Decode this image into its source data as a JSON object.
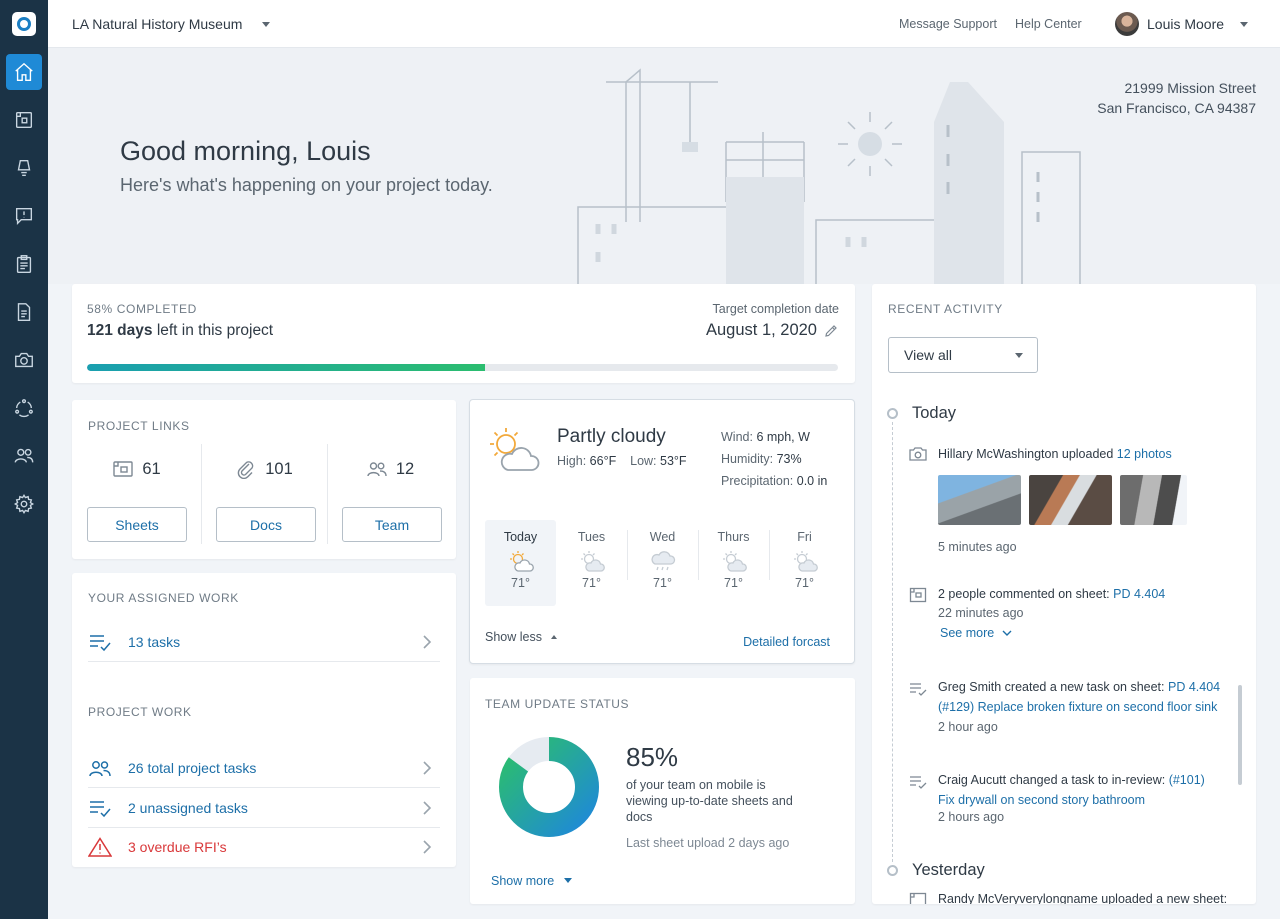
{
  "app": {
    "project_name": "LA Natural History Museum"
  },
  "topbar": {
    "message_support": "Message Support",
    "help_center": "Help Center",
    "user_name": "Louis Moore"
  },
  "sidebar": {
    "items": [
      {
        "icon": "home-icon",
        "active": true
      },
      {
        "icon": "sheets-icon",
        "active": false
      },
      {
        "icon": "tasks-icon",
        "active": false
      },
      {
        "icon": "rfi-icon",
        "active": false
      },
      {
        "icon": "clipboard-icon",
        "active": false
      },
      {
        "icon": "docs-icon",
        "active": false
      },
      {
        "icon": "camera-icon",
        "active": false
      },
      {
        "icon": "network-icon",
        "active": false
      },
      {
        "icon": "team-icon",
        "active": false
      },
      {
        "icon": "settings-icon",
        "active": false
      }
    ]
  },
  "hero": {
    "greeting": "Good morning, Louis",
    "subgreeting": "Here's what's happening on your project today.",
    "address_line1": "21999 Mission Street",
    "address_line2": "San Francisco, CA 94387"
  },
  "progress": {
    "completed_label": "58% COMPLETED",
    "completed_fraction": 0.53,
    "days_bold": "121 days",
    "days_rest": "left in this project",
    "target_label": "Target completion date",
    "target_date": "August 1, 2020"
  },
  "project_links": {
    "label": "PROJECT LINKS",
    "items": [
      {
        "count": "61",
        "button": "Sheets",
        "icon": "sheets-icon"
      },
      {
        "count": "101",
        "button": "Docs",
        "icon": "paperclip-icon"
      },
      {
        "count": "12",
        "button": "Team",
        "icon": "team-icon"
      }
    ]
  },
  "assigned_work": {
    "label": "YOUR ASSIGNED WORK",
    "tasks": "13 tasks"
  },
  "project_work": {
    "label": "PROJECT WORK",
    "total_tasks": "26 total project tasks",
    "unassigned": "2 unassigned tasks",
    "overdue": "3 overdue RFI’s"
  },
  "weather": {
    "condition": "Partly cloudy",
    "high_label": "High:",
    "high": "66°F",
    "low_label": "Low:",
    "low": "53°F",
    "wind_label": "Wind:",
    "wind": "6 mph, W",
    "humidity_label": "Humidity:",
    "humidity": "73%",
    "precip_label": "Precipitation:",
    "precip": "0.0 in",
    "forecast": [
      {
        "day": "Today",
        "temp": "71°",
        "icon": "partly-cloudy-icon"
      },
      {
        "day": "Tues",
        "temp": "71°",
        "icon": "partly-cloudy-icon"
      },
      {
        "day": "Wed",
        "temp": "71°",
        "icon": "rain-icon"
      },
      {
        "day": "Thurs",
        "temp": "71°",
        "icon": "partly-cloudy-icon"
      },
      {
        "day": "Fri",
        "temp": "71°",
        "icon": "partly-cloudy-icon"
      }
    ],
    "show_less": "Show less",
    "detailed": "Detailed forcast"
  },
  "team_status": {
    "label": "TEAM UPDATE STATUS",
    "percent": "85%",
    "percent_value": 0.85,
    "description": "of your team on mobile is viewing up-to-date sheets and docs",
    "last_upload": "Last sheet upload 2 days ago",
    "show_more": "Show more",
    "colors": {
      "start": "#2bbd6f",
      "end": "#1f8ad6",
      "rest": "#e6ebf1"
    }
  },
  "activity": {
    "label": "RECENT ACTIVITY",
    "filter": "View all",
    "today": "Today",
    "yesterday": "Yesterday",
    "items": [
      {
        "pre": "Hillary McWashington uploaded ",
        "link": "12 photos",
        "time": "5 minutes ago"
      },
      {
        "pre": "2 people commented on sheet: ",
        "link": "PD 4.404",
        "time": "22 minutes ago",
        "see_more": "See more"
      },
      {
        "pre": "Greg Smith created a new task on sheet: ",
        "link": "PD 4.404",
        "link2": "(#129) Replace broken fixture on second floor sink",
        "time": "2 hour ago"
      },
      {
        "pre": "Craig Aucutt changed a task to in-review: ",
        "link": "(#101)",
        "link2": "Fix drywall on second story bathroom",
        "time": "2 hours ago"
      },
      {
        "pre": "Randy McVeryverylongname uploaded a new sheet:"
      }
    ]
  },
  "colors": {
    "accent": "#1f8ad6",
    "link": "#1d6fa8",
    "sidebar": "#1b3346",
    "danger": "#d9383a"
  }
}
